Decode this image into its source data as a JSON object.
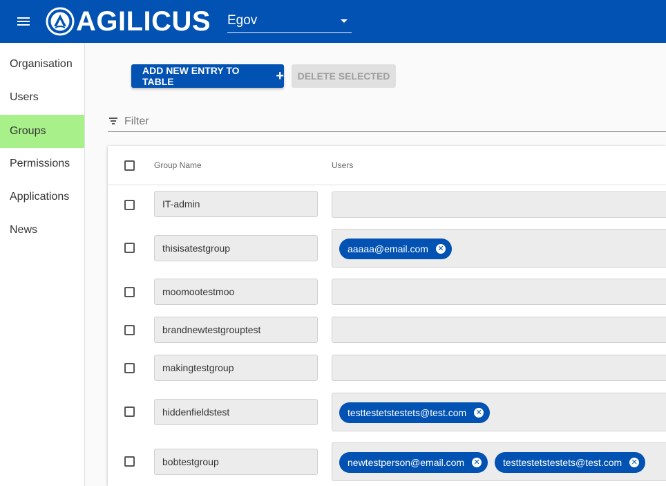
{
  "header": {
    "logo_text": "AGILICUS",
    "org_select_value": "Egov"
  },
  "sidebar": {
    "items": [
      {
        "label": "Organisation"
      },
      {
        "label": "Users"
      },
      {
        "label": "Groups"
      },
      {
        "label": "Permissions"
      },
      {
        "label": "Applications"
      },
      {
        "label": "News"
      }
    ],
    "active": "Groups"
  },
  "toolbar": {
    "add_label": "ADD NEW ENTRY TO TABLE",
    "delete_label": "DELETE SELECTED"
  },
  "filter": {
    "placeholder": "Filter",
    "value": ""
  },
  "table": {
    "columns": {
      "name": "Group Name",
      "users": "Users"
    },
    "rows": [
      {
        "name": "IT-admin",
        "users": []
      },
      {
        "name": "thisisatestgroup",
        "users": [
          "aaaaa@email.com"
        ]
      },
      {
        "name": "moomootestmoo",
        "users": []
      },
      {
        "name": "brandnewtestgrouptest",
        "users": []
      },
      {
        "name": "makingtestgroup",
        "users": []
      },
      {
        "name": "hiddenfieldstest",
        "users": [
          "testtestetstestets@test.com"
        ]
      },
      {
        "name": "bobtestgroup",
        "users": [
          "newtestperson@email.com",
          "testtestetstestets@test.com"
        ]
      }
    ]
  },
  "colors": {
    "primary": "#0152b2",
    "active_nav": "#a8f08a",
    "disabled_button": "#e0e0e0"
  }
}
